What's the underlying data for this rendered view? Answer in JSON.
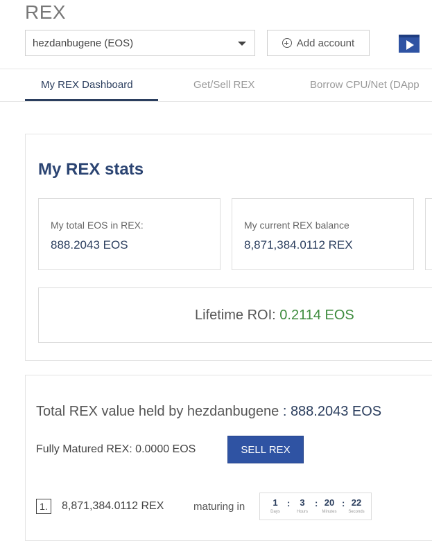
{
  "app": {
    "title": "REX"
  },
  "account": {
    "selected": "hezdanbugene (EOS)",
    "add_label": "Add account"
  },
  "tabs": [
    {
      "label": "My REX Dashboard",
      "active": true
    },
    {
      "label": "Get/Sell REX",
      "active": false
    },
    {
      "label": "Borrow CPU/Net (DApp",
      "active": false
    }
  ],
  "stats": {
    "title": "My REX stats",
    "cards": [
      {
        "label": "My total EOS in REX:",
        "value": "888.2043 EOS"
      },
      {
        "label": "My current REX balance",
        "value": "8,871,384.0112 REX"
      }
    ],
    "roi_label": "Lifetime ROI:",
    "roi_value": "0.2114 EOS"
  },
  "holdings": {
    "total_prefix": "Total REX value held by hezdanbugene",
    "total_sep": " : ",
    "total_value": "888.2043 EOS",
    "matured_label": "Fully Matured REX:",
    "matured_value": "0.0000 EOS",
    "sell_label": "SELL REX",
    "rows": [
      {
        "index": "1.",
        "amount": "8,871,384.0112 REX",
        "maturing_label": "maturing in",
        "countdown": {
          "days": "1",
          "days_label": "Days",
          "hours": "3",
          "hours_label": "Hours",
          "minutes": "20",
          "minutes_label": "Minutes",
          "seconds": "22",
          "seconds_label": "Seconds"
        }
      }
    ]
  },
  "colors": {
    "accent": "#2f53a3",
    "heading": "#2b4472",
    "positive": "#3d8b3d"
  }
}
